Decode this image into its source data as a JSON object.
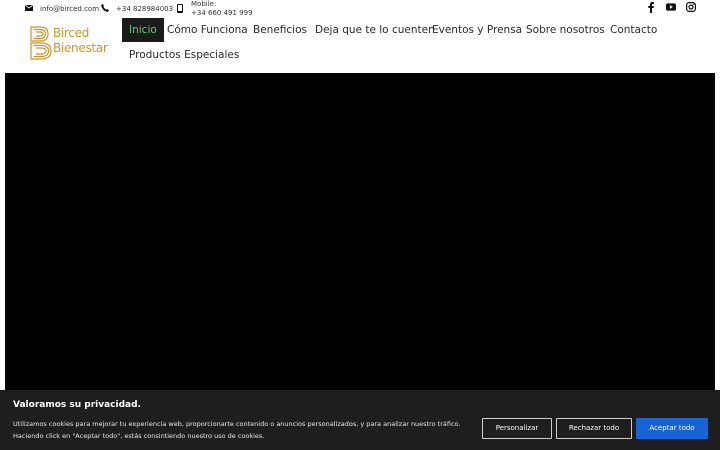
{
  "topbar": {
    "email": "info@birced.com",
    "phone": "+34 828984003",
    "mobile_label": "Mobile:",
    "mobile_number": "+34 660 491 999",
    "social_icons": [
      "facebook-icon",
      "youtube-icon",
      "instagram-icon"
    ]
  },
  "logo": {
    "line1": "Birced",
    "line2": "Bienestar"
  },
  "nav": {
    "items": [
      {
        "label": "Inicio"
      },
      {
        "label": "Cómo Funciona"
      },
      {
        "label": "Beneficios"
      },
      {
        "label": "Deja que te lo cuenten"
      },
      {
        "label": "Eventos y Prensa"
      },
      {
        "label": "Sobre nosotros"
      },
      {
        "label": "Contacto"
      },
      {
        "label": "Productos Especiales"
      }
    ]
  },
  "cookie": {
    "title": "Valoramos su privacidad.",
    "line1": "Utilizamos cookies para mejorar tu experiencia web, proporcionarte contenido o anuncios personalizados, y para analizar nuestro tráfico.",
    "line2": "Haciendo click en \"Aceptar todo\", estás consintiendo nuestro uso de cookies.",
    "customize_label": "Personalizar",
    "reject_label": "Rechazar todo",
    "accept_label": "Aceptar todo"
  },
  "colors": {
    "brand_gold": "#c8962e",
    "accept_blue": "#1864d6",
    "active_nav_bg": "#1b1b1b"
  }
}
